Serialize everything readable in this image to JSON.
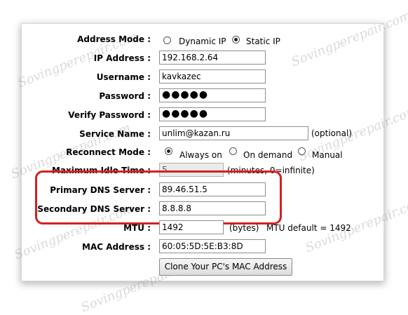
{
  "watermark": "Sovingperepair.com",
  "form": {
    "address_mode": {
      "label": "Address Mode :",
      "options": [
        "Dynamic IP",
        "Static IP"
      ],
      "selected": "Static IP"
    },
    "ip_address": {
      "label": "IP Address :",
      "value": "192.168.2.64"
    },
    "username": {
      "label": "Username :",
      "value": "kavkazec"
    },
    "password": {
      "label": "Password :",
      "value": "●●●●●"
    },
    "verify_password": {
      "label": "Verify Password :",
      "value": "●●●●●"
    },
    "service_name": {
      "label": "Service Name :",
      "value": "unlim@kazan.ru",
      "note": "(optional)"
    },
    "reconnect_mode": {
      "label": "Reconnect Mode :",
      "options": [
        "Always on",
        "On demand",
        "Manual"
      ],
      "selected": "Always on"
    },
    "max_idle_time": {
      "label": "Maximum Idle Time :",
      "value": "5",
      "note": "(minutes, 0=infinite)"
    },
    "primary_dns": {
      "label": "Primary DNS Server :",
      "value": "89.46.51.5"
    },
    "secondary_dns": {
      "label": "Secondary DNS Server :",
      "value": "8.8.8.8"
    },
    "mtu": {
      "label": "MTU :",
      "value": "1492",
      "unit": "(bytes)",
      "default_note": "MTU default = 1492"
    },
    "mac_address": {
      "label": "MAC Address :",
      "value": "60:05:5D:5E:B3:8D"
    },
    "clone_button": "Clone Your PC's MAC Address"
  },
  "colors": {
    "highlight": "#d42020"
  }
}
